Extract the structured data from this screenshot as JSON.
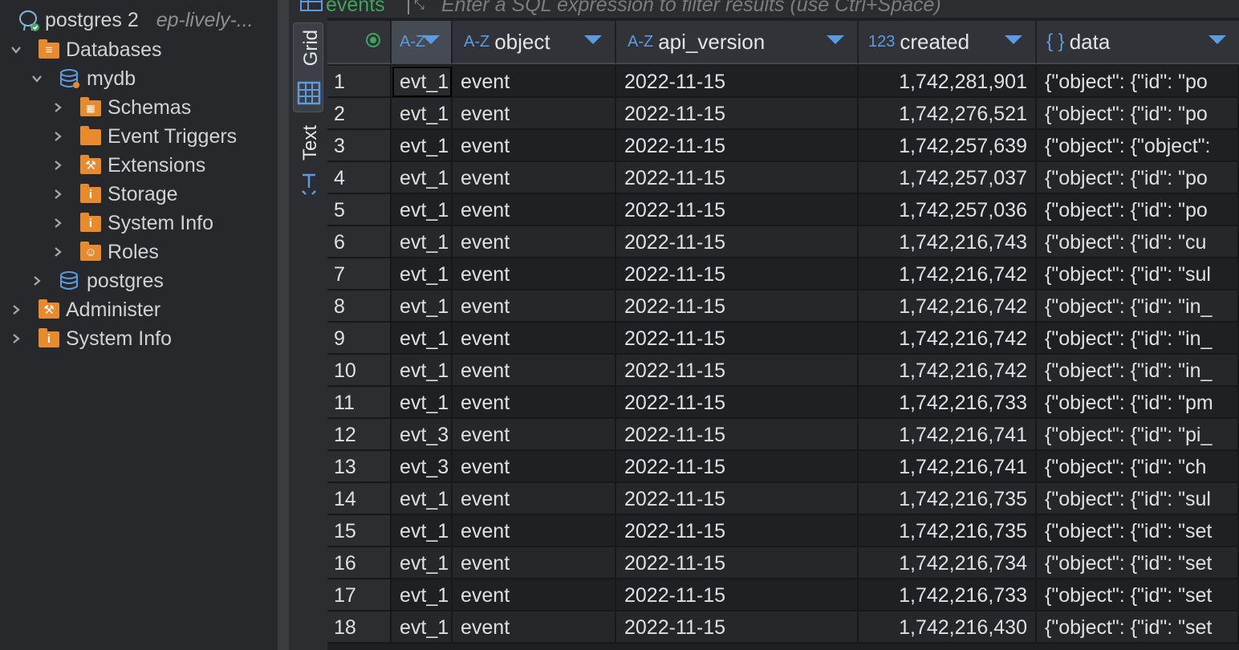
{
  "navigator": {
    "connection": {
      "name": "postgres 2",
      "host": "ep-lively-..."
    },
    "databases_label": "Databases",
    "db": {
      "name": "mydb"
    },
    "db_children": [
      "Schemas",
      "Event Triggers",
      "Extensions",
      "Storage",
      "System Info",
      "Roles"
    ],
    "other_db": "postgres",
    "conn_children": [
      "Administer",
      "System Info"
    ]
  },
  "editor": {
    "tab_name": "events",
    "filter_placeholder": "Enter a SQL expression to filter results (use Ctrl+Space)"
  },
  "view_modes": {
    "grid": "Grid",
    "text": "Text"
  },
  "grid": {
    "columns": [
      {
        "type": "A-Z",
        "name": ""
      },
      {
        "type": "A-Z",
        "name": "object"
      },
      {
        "type": "A-Z",
        "name": "api_version"
      },
      {
        "type": "123",
        "name": "created"
      },
      {
        "type": "{ }",
        "name": "data"
      }
    ],
    "rows": [
      {
        "n": "1",
        "id": "evt_1",
        "object": "event",
        "api_version": "2022-11-15",
        "created": "1,742,281,901",
        "data": "{\"object\": {\"id\": \"po"
      },
      {
        "n": "2",
        "id": "evt_1",
        "object": "event",
        "api_version": "2022-11-15",
        "created": "1,742,276,521",
        "data": "{\"object\": {\"id\": \"po"
      },
      {
        "n": "3",
        "id": "evt_1",
        "object": "event",
        "api_version": "2022-11-15",
        "created": "1,742,257,639",
        "data": "{\"object\": {\"object\":"
      },
      {
        "n": "4",
        "id": "evt_1",
        "object": "event",
        "api_version": "2022-11-15",
        "created": "1,742,257,037",
        "data": "{\"object\": {\"id\": \"po"
      },
      {
        "n": "5",
        "id": "evt_1",
        "object": "event",
        "api_version": "2022-11-15",
        "created": "1,742,257,036",
        "data": "{\"object\": {\"id\": \"po"
      },
      {
        "n": "6",
        "id": "evt_1",
        "object": "event",
        "api_version": "2022-11-15",
        "created": "1,742,216,743",
        "data": "{\"object\": {\"id\": \"cu"
      },
      {
        "n": "7",
        "id": "evt_1",
        "object": "event",
        "api_version": "2022-11-15",
        "created": "1,742,216,742",
        "data": "{\"object\": {\"id\": \"sul"
      },
      {
        "n": "8",
        "id": "evt_1",
        "object": "event",
        "api_version": "2022-11-15",
        "created": "1,742,216,742",
        "data": "{\"object\": {\"id\": \"in_"
      },
      {
        "n": "9",
        "id": "evt_1",
        "object": "event",
        "api_version": "2022-11-15",
        "created": "1,742,216,742",
        "data": "{\"object\": {\"id\": \"in_"
      },
      {
        "n": "10",
        "id": "evt_1",
        "object": "event",
        "api_version": "2022-11-15",
        "created": "1,742,216,742",
        "data": "{\"object\": {\"id\": \"in_"
      },
      {
        "n": "11",
        "id": "evt_1",
        "object": "event",
        "api_version": "2022-11-15",
        "created": "1,742,216,733",
        "data": "{\"object\": {\"id\": \"pm"
      },
      {
        "n": "12",
        "id": "evt_3",
        "object": "event",
        "api_version": "2022-11-15",
        "created": "1,742,216,741",
        "data": "{\"object\": {\"id\": \"pi_"
      },
      {
        "n": "13",
        "id": "evt_3",
        "object": "event",
        "api_version": "2022-11-15",
        "created": "1,742,216,741",
        "data": "{\"object\": {\"id\": \"ch"
      },
      {
        "n": "14",
        "id": "evt_1",
        "object": "event",
        "api_version": "2022-11-15",
        "created": "1,742,216,735",
        "data": "{\"object\": {\"id\": \"sul"
      },
      {
        "n": "15",
        "id": "evt_1",
        "object": "event",
        "api_version": "2022-11-15",
        "created": "1,742,216,735",
        "data": "{\"object\": {\"id\": \"set"
      },
      {
        "n": "16",
        "id": "evt_1",
        "object": "event",
        "api_version": "2022-11-15",
        "created": "1,742,216,734",
        "data": "{\"object\": {\"id\": \"set"
      },
      {
        "n": "17",
        "id": "evt_1",
        "object": "event",
        "api_version": "2022-11-15",
        "created": "1,742,216,733",
        "data": "{\"object\": {\"id\": \"set"
      },
      {
        "n": "18",
        "id": "evt_1",
        "object": "event",
        "api_version": "2022-11-15",
        "created": "1,742,216,430",
        "data": "{\"object\": {\"id\": \"set"
      }
    ]
  },
  "colors": {
    "folder": "#e88a2e",
    "type_icon": "#5c9be0",
    "accent_green": "#3fa55b",
    "db_blue": "#5c9be0"
  }
}
